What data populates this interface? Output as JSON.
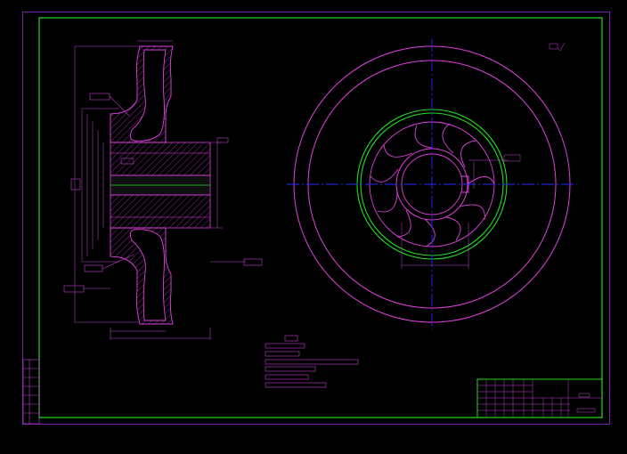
{
  "colors": {
    "background": "#000000",
    "sheet_border": "#7a20a8",
    "drawing_frame": "#22dd22",
    "outline": "#e040e0",
    "centerline": "#2a2aff",
    "dimension": "#c040d0",
    "hatch": "#b030c0",
    "vane_ring": "#22dd22",
    "cutting_line": "#22dd22"
  },
  "notes": {
    "heading": "",
    "lines": [
      "",
      "",
      "",
      "",
      ""
    ]
  },
  "title_block": {
    "drawing_name": "",
    "drawing_number": ""
  },
  "views": {
    "section_view": "impeller-section",
    "front_view": "impeller-front"
  }
}
